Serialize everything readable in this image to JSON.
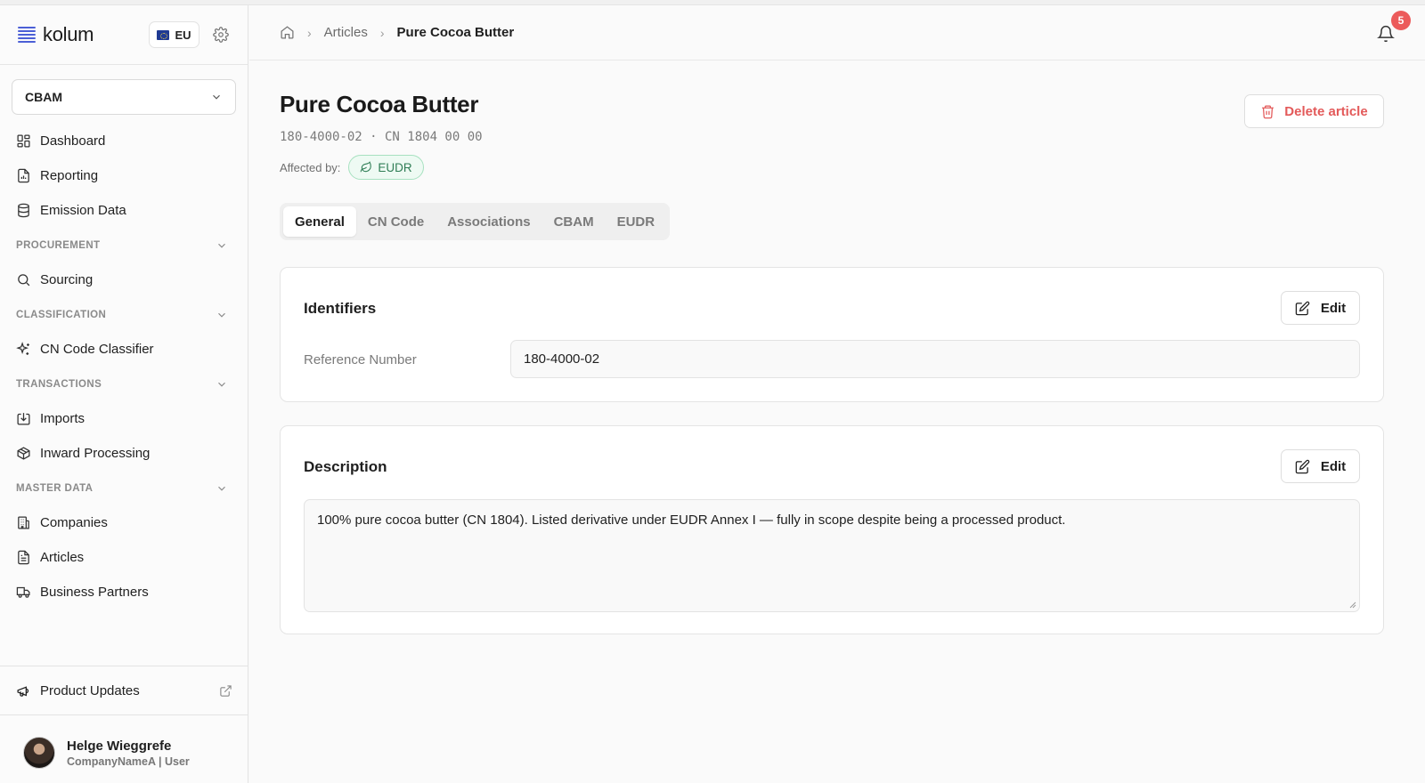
{
  "app": {
    "name": "kolum",
    "region": "EU"
  },
  "sidebar": {
    "module": "CBAM",
    "top_items": [
      {
        "label": "Dashboard"
      },
      {
        "label": "Reporting"
      },
      {
        "label": "Emission Data"
      }
    ],
    "sections": [
      {
        "title": "PROCUREMENT",
        "items": [
          {
            "label": "Sourcing"
          }
        ]
      },
      {
        "title": "CLASSIFICATION",
        "items": [
          {
            "label": "CN Code Classifier"
          }
        ]
      },
      {
        "title": "TRANSACTIONS",
        "items": [
          {
            "label": "Imports"
          },
          {
            "label": "Inward Processing"
          }
        ]
      },
      {
        "title": "MASTER DATA",
        "items": [
          {
            "label": "Companies"
          },
          {
            "label": "Articles"
          },
          {
            "label": "Business Partners"
          }
        ]
      }
    ],
    "product_updates": "Product Updates",
    "user": {
      "name": "Helge Wieggrefe",
      "subtitle": "CompanyNameA | User"
    }
  },
  "header": {
    "breadcrumb": {
      "parent": "Articles",
      "current": "Pure Cocoa Butter"
    },
    "notifications_count": "5"
  },
  "article": {
    "title": "Pure Cocoa Butter",
    "meta": "180-4000-02 · CN 1804 00 00",
    "affected_label": "Affected by:",
    "affected_tag": "EUDR",
    "delete_label": "Delete article"
  },
  "tabs": [
    {
      "label": "General",
      "active": true
    },
    {
      "label": "CN Code"
    },
    {
      "label": "Associations"
    },
    {
      "label": "CBAM"
    },
    {
      "label": "EUDR"
    }
  ],
  "identifiers": {
    "title": "Identifiers",
    "edit_label": "Edit",
    "ref_label": "Reference Number",
    "ref_value": "180-4000-02"
  },
  "description": {
    "title": "Description",
    "edit_label": "Edit",
    "text": "100% pure cocoa butter (CN 1804). Listed derivative under EUDR Annex I — fully in scope despite being a processed product."
  },
  "colors": {
    "brand": "#4b5fd6",
    "danger": "#e35a5a",
    "success": "#2f7d55",
    "badge": "#ec5b5b"
  }
}
